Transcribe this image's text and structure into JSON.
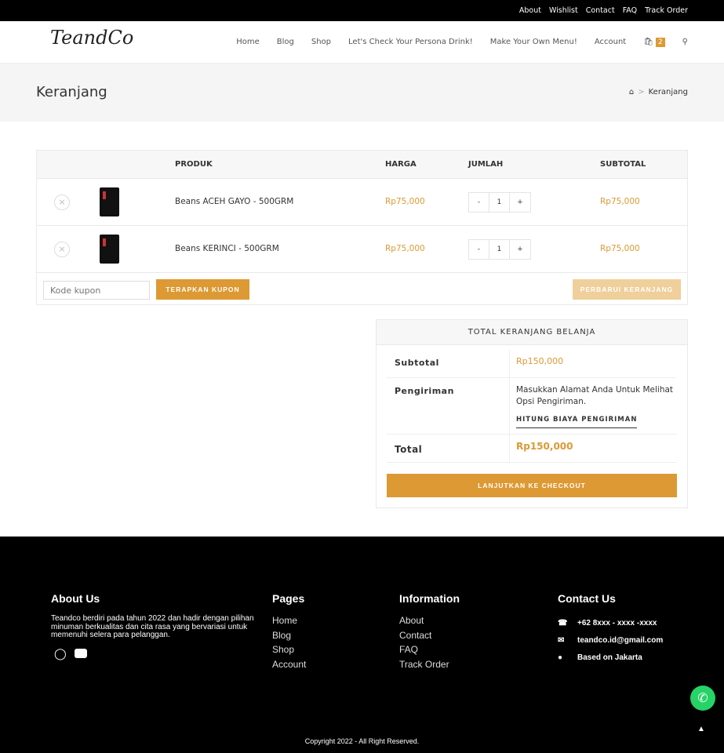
{
  "topbar": {
    "links": [
      "About",
      "Wishlist",
      "Contact",
      "FAQ",
      "Track Order"
    ]
  },
  "header": {
    "logo": "TeandCo",
    "nav": [
      "Home",
      "Blog",
      "Shop",
      "Let's Check Your Persona Drink!",
      "Make Your Own Menu!",
      "Account"
    ],
    "cart_count": "2"
  },
  "page": {
    "title": "Keranjang",
    "breadcrumb": "Keranjang"
  },
  "cart": {
    "headers": {
      "product": "PRODUK",
      "price": "HARGA",
      "qty": "JUMLAH",
      "subtotal": "SUBTOTAL"
    },
    "items": [
      {
        "name": "Beans ACEH GAYO - 500GRM",
        "price": "Rp75,000",
        "qty": "1",
        "subtotal": "Rp75,000"
      },
      {
        "name": "Beans KERINCI - 500GRM",
        "price": "Rp75,000",
        "qty": "1",
        "subtotal": "Rp75,000"
      }
    ],
    "coupon_placeholder": "Kode kupon",
    "apply_coupon": "TERAPKAN KUPON",
    "update_cart": "PERBARUI KERANJANG"
  },
  "totals": {
    "title": "TOTAL KERANJANG BELANJA",
    "subtotal_label": "Subtotal",
    "subtotal": "Rp150,000",
    "shipping_label": "Pengiriman",
    "shipping_text": "Masukkan Alamat Anda Untuk Melihat Opsi Pengiriman.",
    "shipping_calc": "HITUNG BIAYA PENGIRIMAN",
    "total_label": "Total",
    "total": "Rp150,000",
    "checkout": "LANJUTKAN KE CHECKOUT"
  },
  "footer": {
    "about_title": "About Us",
    "about_text": "Teandco berdiri pada tahun 2022 dan hadir dengan pilihan minuman berkualitas dan cita rasa yang bervariasi untuk memenuhi selera para pelanggan.",
    "pages_title": "Pages",
    "pages": [
      "Home",
      "Blog",
      "Shop",
      "Account"
    ],
    "info_title": "Information",
    "info": [
      "About",
      "Contact",
      "FAQ",
      "Track Order"
    ],
    "contact_title": "Contact Us",
    "phone": "+62 8xxx - xxxx -xxxx",
    "email": "teandco.id@gmail.com",
    "location": "Based on Jakarta",
    "copyright": "Copyright 2022 - All Right Reserved."
  },
  "colors": {
    "accent": "#dd9933"
  }
}
